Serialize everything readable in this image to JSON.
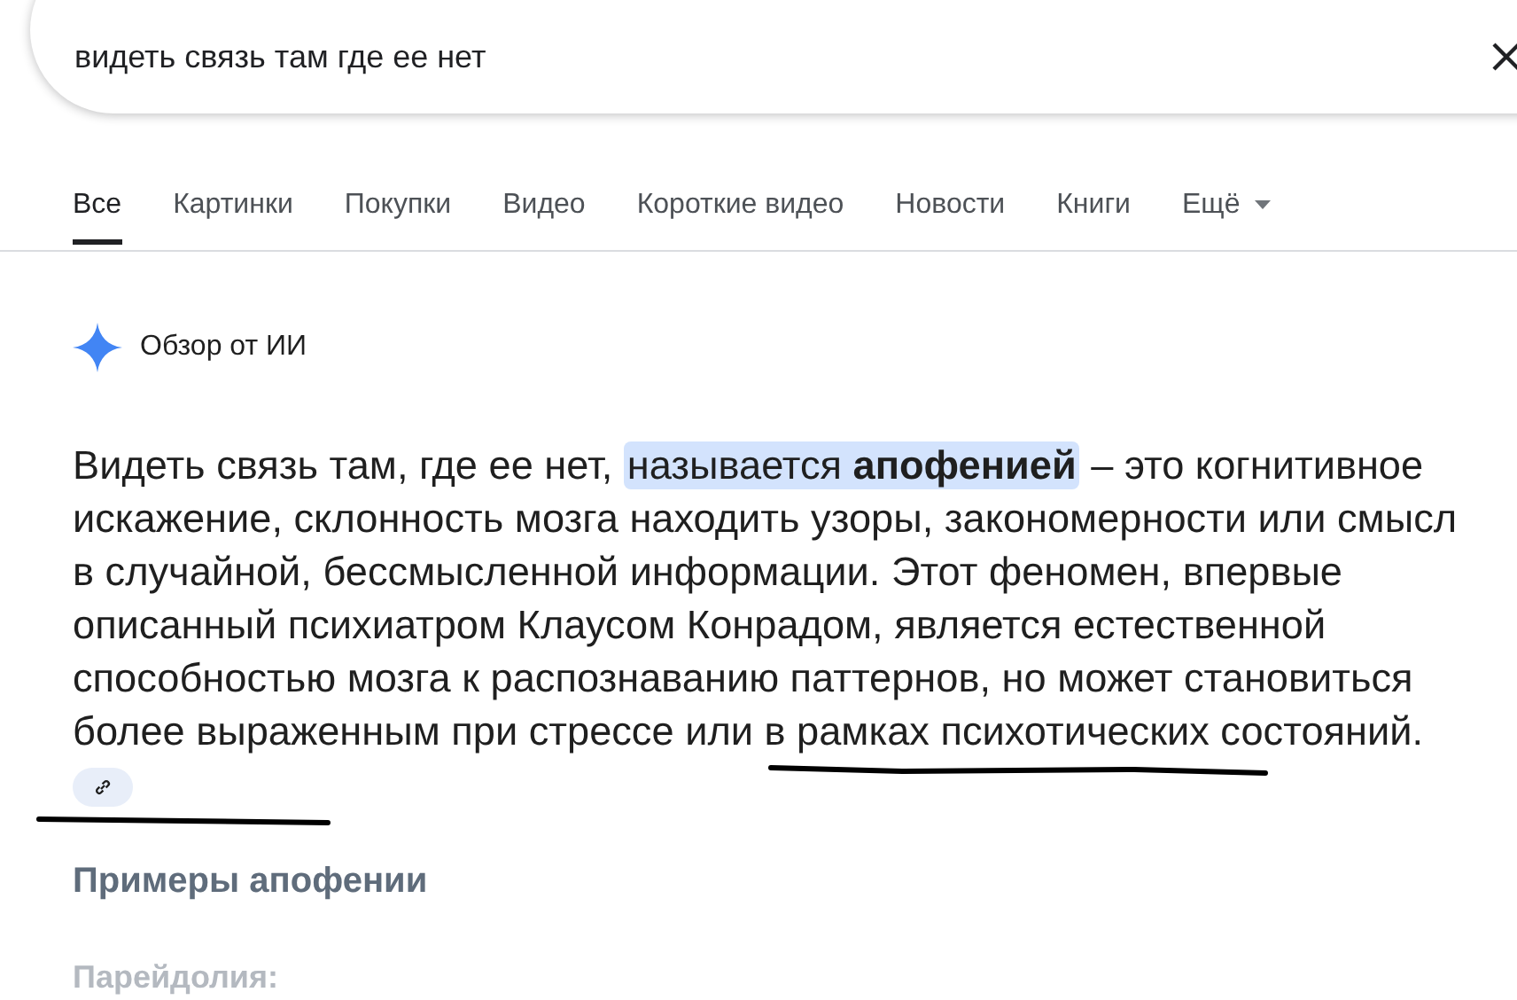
{
  "search": {
    "value": "видеть связь там где ее нет"
  },
  "tabs": [
    {
      "label": "Все",
      "selected": true
    },
    {
      "label": "Картинки",
      "selected": false
    },
    {
      "label": "Покупки",
      "selected": false
    },
    {
      "label": "Видео",
      "selected": false
    },
    {
      "label": "Короткие видео",
      "selected": false
    },
    {
      "label": "Новости",
      "selected": false
    },
    {
      "label": "Книги",
      "selected": false
    },
    {
      "label": "Ещё",
      "selected": false,
      "kind": "menu"
    }
  ],
  "ai_overview": {
    "title": "Обзор от ИИ",
    "answer": {
      "before": "Видеть связь там, где ее нет, ",
      "highlight": "называется **апофенией**",
      "after": " – это когнитивное искажение, склонность мозга находить узоры, закономерности или смысл в случайной, бессмысленной информации. Этот феномен, впервые описанный психиатром Клаусом Конрадом, является естественной способностью мозга к распознаванию паттернов, но может становиться более выраженным при стрессе или в рамках психотических состояний."
    },
    "heading": "Примеры апофении",
    "subheading": "Парейдолия:"
  }
}
